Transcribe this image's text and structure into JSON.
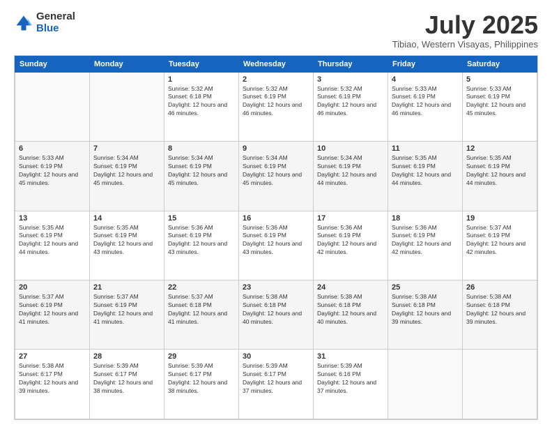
{
  "logo": {
    "general": "General",
    "blue": "Blue"
  },
  "title": {
    "month_year": "July 2025",
    "location": "Tibiao, Western Visayas, Philippines"
  },
  "calendar": {
    "headers": [
      "Sunday",
      "Monday",
      "Tuesday",
      "Wednesday",
      "Thursday",
      "Friday",
      "Saturday"
    ],
    "rows": [
      [
        {
          "day": "",
          "info": ""
        },
        {
          "day": "",
          "info": ""
        },
        {
          "day": "1",
          "info": "Sunrise: 5:32 AM\nSunset: 6:18 PM\nDaylight: 12 hours and 46 minutes."
        },
        {
          "day": "2",
          "info": "Sunrise: 5:32 AM\nSunset: 6:19 PM\nDaylight: 12 hours and 46 minutes."
        },
        {
          "day": "3",
          "info": "Sunrise: 5:32 AM\nSunset: 6:19 PM\nDaylight: 12 hours and 46 minutes."
        },
        {
          "day": "4",
          "info": "Sunrise: 5:33 AM\nSunset: 6:19 PM\nDaylight: 12 hours and 46 minutes."
        },
        {
          "day": "5",
          "info": "Sunrise: 5:33 AM\nSunset: 6:19 PM\nDaylight: 12 hours and 45 minutes."
        }
      ],
      [
        {
          "day": "6",
          "info": "Sunrise: 5:33 AM\nSunset: 6:19 PM\nDaylight: 12 hours and 45 minutes."
        },
        {
          "day": "7",
          "info": "Sunrise: 5:34 AM\nSunset: 6:19 PM\nDaylight: 12 hours and 45 minutes."
        },
        {
          "day": "8",
          "info": "Sunrise: 5:34 AM\nSunset: 6:19 PM\nDaylight: 12 hours and 45 minutes."
        },
        {
          "day": "9",
          "info": "Sunrise: 5:34 AM\nSunset: 6:19 PM\nDaylight: 12 hours and 45 minutes."
        },
        {
          "day": "10",
          "info": "Sunrise: 5:34 AM\nSunset: 6:19 PM\nDaylight: 12 hours and 44 minutes."
        },
        {
          "day": "11",
          "info": "Sunrise: 5:35 AM\nSunset: 6:19 PM\nDaylight: 12 hours and 44 minutes."
        },
        {
          "day": "12",
          "info": "Sunrise: 5:35 AM\nSunset: 6:19 PM\nDaylight: 12 hours and 44 minutes."
        }
      ],
      [
        {
          "day": "13",
          "info": "Sunrise: 5:35 AM\nSunset: 6:19 PM\nDaylight: 12 hours and 44 minutes."
        },
        {
          "day": "14",
          "info": "Sunrise: 5:35 AM\nSunset: 6:19 PM\nDaylight: 12 hours and 43 minutes."
        },
        {
          "day": "15",
          "info": "Sunrise: 5:36 AM\nSunset: 6:19 PM\nDaylight: 12 hours and 43 minutes."
        },
        {
          "day": "16",
          "info": "Sunrise: 5:36 AM\nSunset: 6:19 PM\nDaylight: 12 hours and 43 minutes."
        },
        {
          "day": "17",
          "info": "Sunrise: 5:36 AM\nSunset: 6:19 PM\nDaylight: 12 hours and 42 minutes."
        },
        {
          "day": "18",
          "info": "Sunrise: 5:36 AM\nSunset: 6:19 PM\nDaylight: 12 hours and 42 minutes."
        },
        {
          "day": "19",
          "info": "Sunrise: 5:37 AM\nSunset: 6:19 PM\nDaylight: 12 hours and 42 minutes."
        }
      ],
      [
        {
          "day": "20",
          "info": "Sunrise: 5:37 AM\nSunset: 6:19 PM\nDaylight: 12 hours and 41 minutes."
        },
        {
          "day": "21",
          "info": "Sunrise: 5:37 AM\nSunset: 6:19 PM\nDaylight: 12 hours and 41 minutes."
        },
        {
          "day": "22",
          "info": "Sunrise: 5:37 AM\nSunset: 6:18 PM\nDaylight: 12 hours and 41 minutes."
        },
        {
          "day": "23",
          "info": "Sunrise: 5:38 AM\nSunset: 6:18 PM\nDaylight: 12 hours and 40 minutes."
        },
        {
          "day": "24",
          "info": "Sunrise: 5:38 AM\nSunset: 6:18 PM\nDaylight: 12 hours and 40 minutes."
        },
        {
          "day": "25",
          "info": "Sunrise: 5:38 AM\nSunset: 6:18 PM\nDaylight: 12 hours and 39 minutes."
        },
        {
          "day": "26",
          "info": "Sunrise: 5:38 AM\nSunset: 6:18 PM\nDaylight: 12 hours and 39 minutes."
        }
      ],
      [
        {
          "day": "27",
          "info": "Sunrise: 5:38 AM\nSunset: 6:17 PM\nDaylight: 12 hours and 39 minutes."
        },
        {
          "day": "28",
          "info": "Sunrise: 5:39 AM\nSunset: 6:17 PM\nDaylight: 12 hours and 38 minutes."
        },
        {
          "day": "29",
          "info": "Sunrise: 5:39 AM\nSunset: 6:17 PM\nDaylight: 12 hours and 38 minutes."
        },
        {
          "day": "30",
          "info": "Sunrise: 5:39 AM\nSunset: 6:17 PM\nDaylight: 12 hours and 37 minutes."
        },
        {
          "day": "31",
          "info": "Sunrise: 5:39 AM\nSunset: 6:16 PM\nDaylight: 12 hours and 37 minutes."
        },
        {
          "day": "",
          "info": ""
        },
        {
          "day": "",
          "info": ""
        }
      ]
    ]
  }
}
